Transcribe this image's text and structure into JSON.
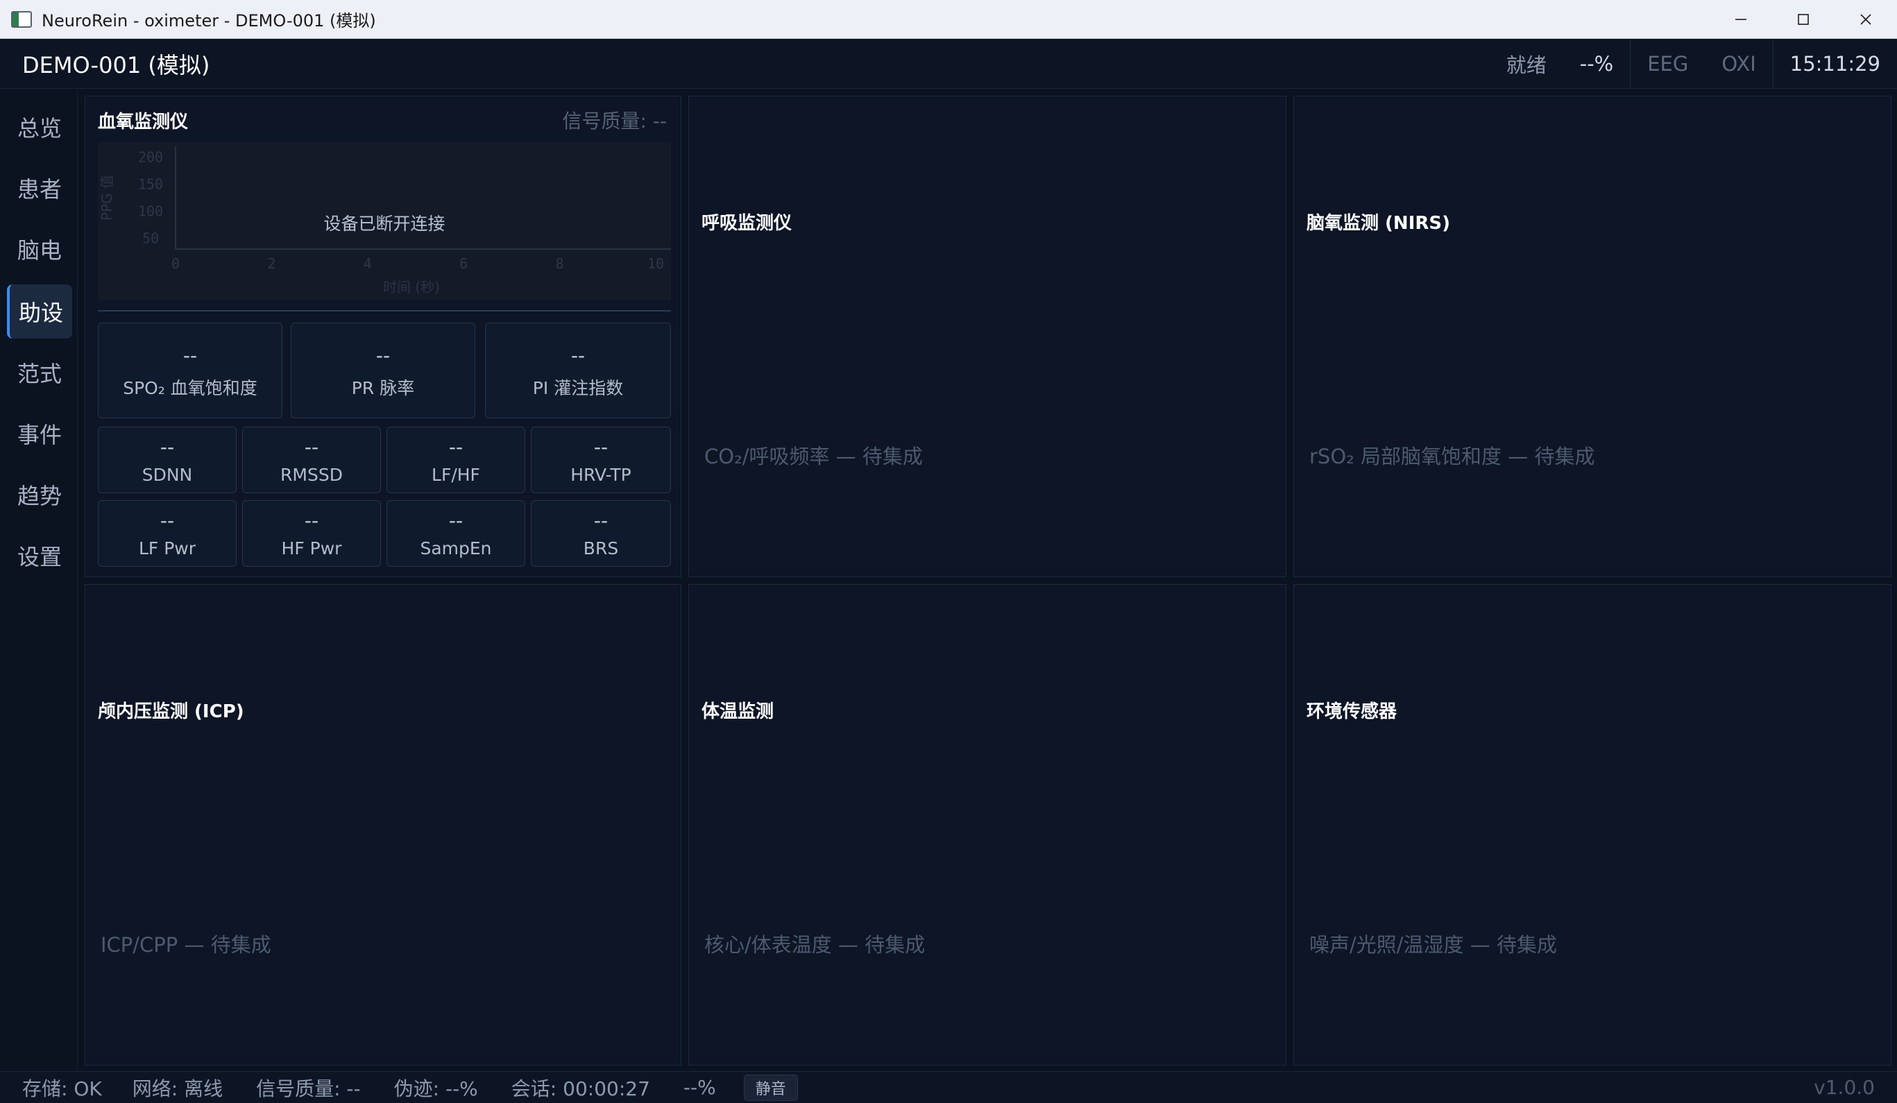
{
  "window": {
    "title": "NeuroRein - oximeter - DEMO-001 (模拟)"
  },
  "header": {
    "patient": "DEMO-001 (模拟)",
    "status": "就绪",
    "battery": "--%",
    "eeg": "EEG",
    "oxi": "OXI",
    "time": "15:11:29"
  },
  "sidebar": {
    "items": [
      {
        "label": "总览"
      },
      {
        "label": "患者"
      },
      {
        "label": "脑电"
      },
      {
        "label": "助设",
        "active": true
      },
      {
        "label": "范式"
      },
      {
        "label": "事件"
      },
      {
        "label": "趋势"
      },
      {
        "label": "设置"
      }
    ]
  },
  "oximeter": {
    "title": "血氧监测仪",
    "signal_quality": "信号质量: --",
    "chart_message": "设备已断开连接",
    "primary": [
      {
        "value": "--",
        "label": "SPO₂ 血氧饱和度"
      },
      {
        "value": "--",
        "label": "PR 脉率"
      },
      {
        "value": "--",
        "label": "PI 灌注指数"
      }
    ],
    "secondary": [
      {
        "value": "--",
        "label": "SDNN"
      },
      {
        "value": "--",
        "label": "RMSSD"
      },
      {
        "value": "--",
        "label": "LF/HF"
      },
      {
        "value": "--",
        "label": "HRV-TP"
      },
      {
        "value": "--",
        "label": "LF Pwr"
      },
      {
        "value": "--",
        "label": "HF Pwr"
      },
      {
        "value": "--",
        "label": "SampEn"
      },
      {
        "value": "--",
        "label": "BRS"
      }
    ]
  },
  "chart_data": {
    "type": "line",
    "title": "",
    "xlabel": "时间 (秒)",
    "ylabel": "PPG 值",
    "xlim": [
      0,
      10
    ],
    "ylim": [
      30,
      220
    ],
    "x_ticks": [
      "0",
      "2",
      "4",
      "6",
      "8",
      "10"
    ],
    "y_ticks": [
      "200",
      "150",
      "100",
      "50"
    ],
    "series": []
  },
  "panels": {
    "respiration": {
      "title": "呼吸监测仪",
      "placeholder": "CO₂/呼吸频率 — 待集成"
    },
    "nirs": {
      "title": "脑氧监测 (NIRS)",
      "placeholder": "rSO₂ 局部脑氧饱和度 — 待集成"
    },
    "icp": {
      "title": "颅内压监测 (ICP)",
      "placeholder": "ICP/CPP — 待集成"
    },
    "temperature": {
      "title": "体温监测",
      "placeholder": "核心/体表温度 — 待集成"
    },
    "environment": {
      "title": "环境传感器",
      "placeholder": "噪声/光照/温湿度 — 待集成"
    }
  },
  "statusbar": {
    "storage": "存储: OK",
    "network": "网络: 离线",
    "signal": "信号质量: --",
    "artifact": "伪迹: --%",
    "session": "会话: 00:00:27",
    "percent": "--%",
    "mute": "静音",
    "version": "v1.0.0"
  }
}
